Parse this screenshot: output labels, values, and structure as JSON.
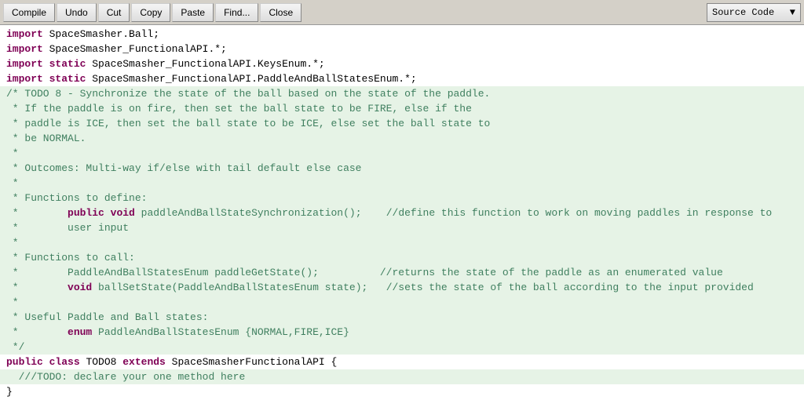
{
  "toolbar": {
    "compile_label": "Compile",
    "undo_label": "Undo",
    "cut_label": "Cut",
    "copy_label": "Copy",
    "paste_label": "Paste",
    "find_label": "Find...",
    "close_label": "Close",
    "source_code_label": "Source Code"
  },
  "code": {
    "imports": [
      "import SpaceSmasher.Ball;",
      "import SpaceSmasher_FunctionalAPI.*;",
      "import static SpaceSmasher_FunctionalAPI.KeysEnum.*;",
      "import static SpaceSmasher_FunctionalAPI.PaddleAndBallStatesEnum.*;"
    ],
    "comment_lines": [
      "/* TODO 8 - Synchronize the state of the ball based on the state of the paddle.",
      " * If the paddle is on fire, then set the ball state to be FIRE, else if the",
      " * paddle is ICE, then set the ball state to be ICE, else set the ball state to",
      " * be NORMAL.",
      " *",
      " * Outcomes: Multi-way if/else with tail default else case",
      " *",
      " * Functions to define:",
      " *        public void paddleAndBallStateSynchronization();    //define this function to work on moving paddles in response to",
      " *        user input",
      " *",
      " * Functions to call:",
      " *        PaddleAndBallStatesEnum paddleGetState();          //returns the state of the paddle as an enumerated value",
      " *        void ballSetState(PaddleAndBallStatesEnum state);   //sets the state of the ball according to the input provided",
      " *",
      " * Useful Paddle and Ball states:",
      " *        enum PaddleAndBallStatesEnum {NORMAL,FIRE,ICE}",
      " */"
    ],
    "class_declaration": "public class TODO8 extends SpaceSmasherFunctionalAPI {",
    "todo_comment": "///TODO: declare your one method here",
    "closing_brace": "}"
  }
}
